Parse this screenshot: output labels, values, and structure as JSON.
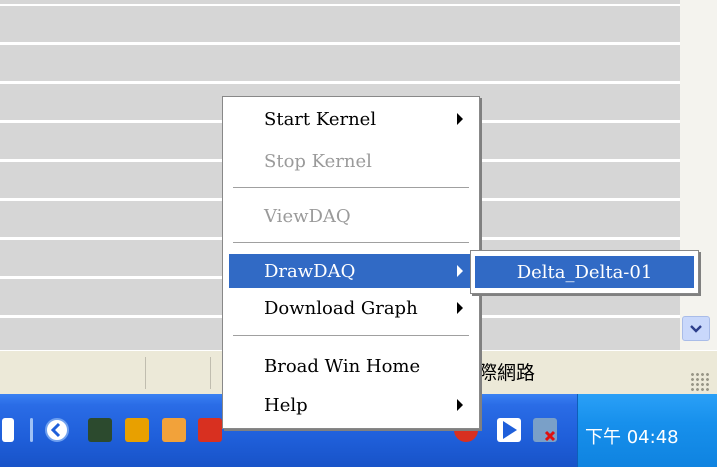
{
  "menu": {
    "items": [
      {
        "label": "Start Kernel",
        "has_submenu": true,
        "enabled": true
      },
      {
        "label": "Stop Kernel",
        "has_submenu": false,
        "enabled": false
      },
      {
        "label": "ViewDAQ",
        "has_submenu": false,
        "enabled": false
      },
      {
        "label": "DrawDAQ",
        "has_submenu": true,
        "enabled": true,
        "highlighted": true
      },
      {
        "label": "Download Graph",
        "has_submenu": true,
        "enabled": true
      },
      {
        "label": "Broad Win Home",
        "has_submenu": false,
        "enabled": true
      },
      {
        "label": "Help",
        "has_submenu": true,
        "enabled": true
      }
    ]
  },
  "submenu": {
    "items": [
      {
        "label": "Delta_Delta-01",
        "highlighted": true
      }
    ]
  },
  "status_bar": {
    "text": "際網路"
  },
  "taskbar": {
    "clock": "下午 04:48",
    "colors": {
      "taskbar": "#1f5fda",
      "tray": "#1790ec",
      "highlight": "#316ac5"
    }
  }
}
